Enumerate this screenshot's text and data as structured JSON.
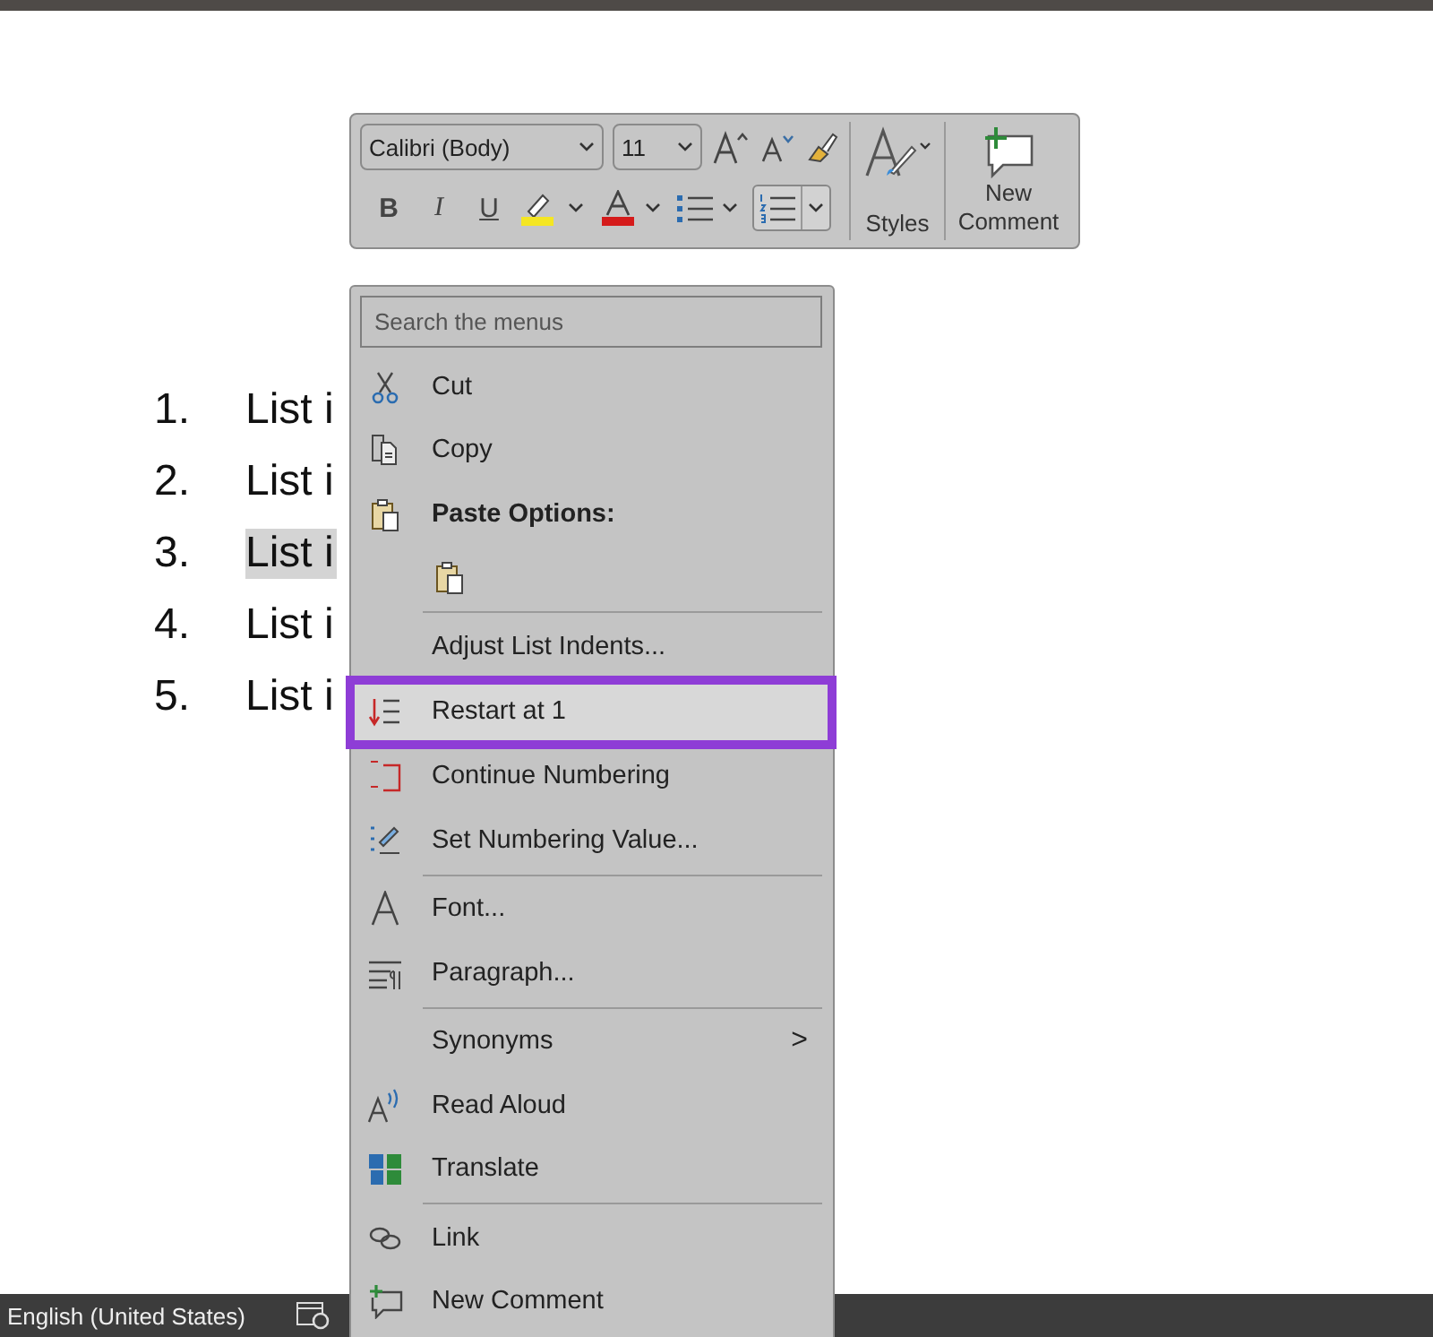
{
  "document": {
    "list": [
      {
        "number": "1.",
        "text": "List i",
        "selected": false
      },
      {
        "number": "2.",
        "text": "List i",
        "selected": false
      },
      {
        "number": "3.",
        "text": "List i",
        "selected": true
      },
      {
        "number": "4.",
        "text": "List i",
        "selected": false
      },
      {
        "number": "5.",
        "text": "List i",
        "selected": false
      }
    ]
  },
  "mini_toolbar": {
    "font": "Calibri (Body)",
    "size": "11",
    "format_buttons": [
      {
        "label": "B",
        "selected": false
      },
      {
        "label": "I",
        "selected": false
      },
      {
        "label": "U",
        "selected": false
      }
    ],
    "numbering_selected": true,
    "styles": "Styles",
    "new_comment": "New Comment"
  },
  "context_menu": {
    "search": {
      "placeholder": "Search the menus"
    },
    "items": [
      {
        "kind": "command",
        "label": "Cut",
        "selected": false
      },
      {
        "kind": "command",
        "label": "Copy",
        "selected": false
      },
      {
        "kind": "header",
        "label": "Paste Options:",
        "selected": false
      },
      {
        "kind": "paste",
        "selected": false
      },
      {
        "kind": "separator"
      },
      {
        "kind": "command",
        "label": "Adjust List Indents...",
        "selected": false
      },
      {
        "kind": "command",
        "label": "Restart at 1",
        "selected": true
      },
      {
        "kind": "command",
        "label": "Continue Numbering",
        "selected": false
      },
      {
        "kind": "command",
        "label": "Set Numbering Value...",
        "selected": false
      },
      {
        "kind": "separator"
      },
      {
        "kind": "command",
        "label": "Font...",
        "selected": false
      },
      {
        "kind": "command",
        "label": "Paragraph...",
        "selected": false
      },
      {
        "kind": "separator"
      },
      {
        "kind": "submenu",
        "label": "Synonyms",
        "arrow": ">",
        "selected": false
      },
      {
        "kind": "command",
        "label": "Read Aloud",
        "selected": false
      },
      {
        "kind": "command",
        "label": "Translate",
        "selected": false
      },
      {
        "kind": "separator"
      },
      {
        "kind": "command",
        "label": "Link",
        "selected": false
      },
      {
        "kind": "command",
        "label": "New Comment",
        "selected": false
      }
    ]
  },
  "status_bar": {
    "language": "English (United States)"
  }
}
